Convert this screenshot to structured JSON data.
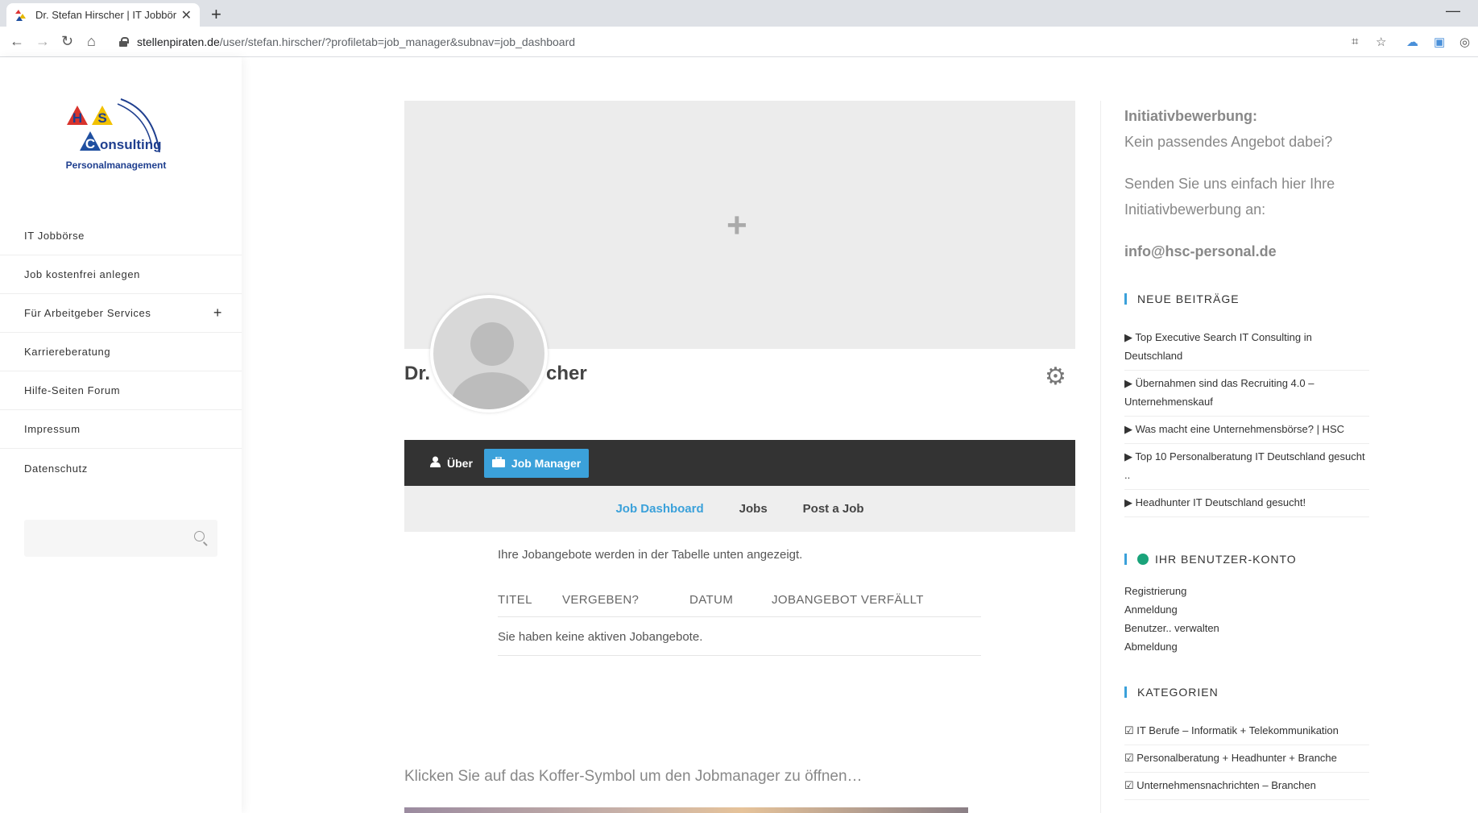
{
  "browser": {
    "tab_title": "Dr. Stefan Hirscher | IT Jobbörse",
    "url_host": "stellenpiraten.de",
    "url_path": "/user/stefan.hirscher/?profiletab=job_manager&subnav=job_dashboard"
  },
  "logo": {
    "letters": [
      "H",
      "S",
      "C",
      "onsulting"
    ],
    "tagline": "Personalmanagement"
  },
  "menu": {
    "items": [
      {
        "label": "IT Jobbörse"
      },
      {
        "label": "Job kostenfrei anlegen"
      },
      {
        "label": "Für Arbeitgeber Services",
        "expand": "+"
      },
      {
        "label": "Karriereberatung"
      },
      {
        "label": "Hilfe-Seiten Forum"
      },
      {
        "label": "Impressum"
      },
      {
        "label": "Datenschutz"
      }
    ],
    "search_placeholder": ""
  },
  "profile": {
    "name_left": "Dr.",
    "name_right": "cher",
    "tabs": [
      {
        "label": "Über",
        "icon": "user-icon",
        "active": false
      },
      {
        "label": "Job Manager",
        "icon": "briefcase-icon",
        "active": true
      }
    ],
    "subnav": [
      {
        "label": "Job Dashboard",
        "active": true
      },
      {
        "label": "Jobs",
        "active": false
      },
      {
        "label": "Post a Job",
        "active": false
      }
    ]
  },
  "jobs": {
    "info": "Ihre Jobangebote werden in der Tabelle unten angezeigt.",
    "columns": [
      "TITEL",
      "VERGEBEN?",
      "DATUM",
      "JOBANGEBOT VERFÄLLT"
    ],
    "empty": "Sie haben keine aktiven Jobangebote."
  },
  "hint": "Klicken Sie auf das Koffer-Symbol um den Jobmanager zu öffnen…",
  "right": {
    "init_title": "Initiativbewerbung:",
    "init_line1": "Kein passendes Angebot dabei?",
    "init_line2": "Senden Sie uns einfach hier Ihre Initiativbewerbung an:",
    "init_email": "info@hsc-personal.de",
    "posts_title": "NEUE BEITRÄGE",
    "posts": [
      "▶ Top Executive Search IT Consulting in Deutschland",
      "▶ Übernahmen sind das Recruiting 4.0 – Unternehmenskauf",
      "▶ Was macht eine Unternehmensbörse? | HSC",
      "▶ Top 10 Personalberatung IT Deutschland gesucht ..",
      "▶ Headhunter IT Deutschland gesucht!"
    ],
    "account_title": "IHR BENUTZER-KONTO",
    "account_links": [
      "Registrierung",
      "Anmeldung",
      "Benutzer.. verwalten",
      "Abmeldung"
    ],
    "cat_title": "KATEGORIEN",
    "categories": [
      "☑ IT Berufe – Informatik + Telekommunikation",
      "☑ Personalberatung + Headhunter + Branche",
      "☑ Unternehmensnachrichten – Branchen"
    ]
  },
  "colors": {
    "accent": "#3ba1da",
    "tabbar": "#333333",
    "online": "#1aa37a"
  }
}
